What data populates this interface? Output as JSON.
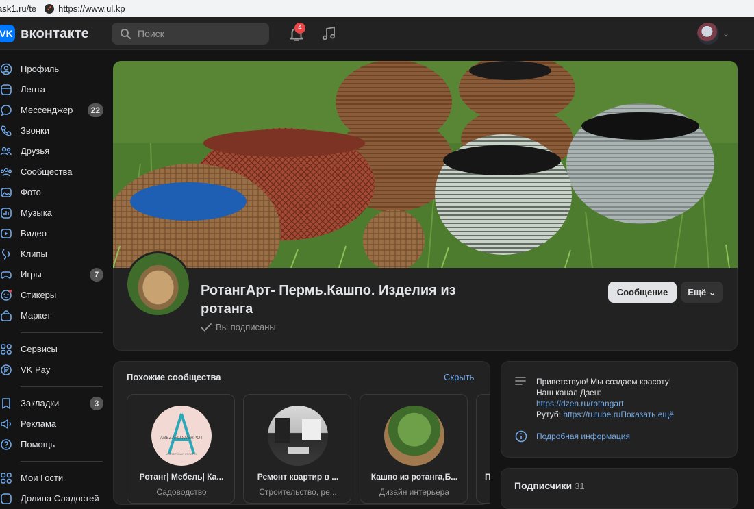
{
  "browser": {
    "bookmark1": "ask1.ru/te",
    "bookmark2": "https://www.ul.kp"
  },
  "header": {
    "logo_text": "вконтакте",
    "search_placeholder": "Поиск",
    "notifications_count": "4"
  },
  "sidebar": {
    "items": [
      {
        "label": "Профиль",
        "icon": "profile-icon"
      },
      {
        "label": "Лента",
        "icon": "feed-icon"
      },
      {
        "label": "Мессенджер",
        "icon": "messenger-icon",
        "count": "22"
      },
      {
        "label": "Звонки",
        "icon": "phone-icon"
      },
      {
        "label": "Друзья",
        "icon": "friends-icon"
      },
      {
        "label": "Сообщества",
        "icon": "communities-icon"
      },
      {
        "label": "Фото",
        "icon": "photo-icon"
      },
      {
        "label": "Музыка",
        "icon": "music-icon"
      },
      {
        "label": "Видео",
        "icon": "video-icon"
      },
      {
        "label": "Клипы",
        "icon": "clips-icon"
      },
      {
        "label": "Игры",
        "icon": "games-icon",
        "count": "7"
      },
      {
        "label": "Стикеры",
        "icon": "stickers-icon"
      },
      {
        "label": "Маркет",
        "icon": "market-icon"
      }
    ],
    "items2": [
      {
        "label": "Сервисы",
        "icon": "services-icon"
      },
      {
        "label": "VK Pay",
        "icon": "vkpay-icon"
      }
    ],
    "items3": [
      {
        "label": "Закладки",
        "icon": "bookmarks-icon",
        "count": "3"
      },
      {
        "label": "Реклама",
        "icon": "ads-icon"
      },
      {
        "label": "Помощь",
        "icon": "help-icon"
      }
    ],
    "items4": [
      {
        "label": "Мои Гости",
        "icon": "guests-icon"
      },
      {
        "label": "Долина Сладостей",
        "icon": "app-icon"
      }
    ]
  },
  "community": {
    "title": "РотангАрт- Пермь.Кашпо. Изделия из ротанга",
    "status": "Вы подписаны",
    "message_button": "Сообщение",
    "more_button": "Ещё"
  },
  "similar": {
    "title": "Похожие сообщества",
    "hide": "Скрыть",
    "tiles": [
      {
        "name": "Ротанг| Мебель| Ка...",
        "category": "Садоводство",
        "logo_text": "ABEZAFLOWERPOT",
        "logo_sub": "МАСТЕРСКАЯ РОТАНГА"
      },
      {
        "name": "Ремонт квартир в ...",
        "category": "Строительство, ре..."
      },
      {
        "name": "Кашпо из ротанга,Б...",
        "category": "Дизайн интерьера"
      },
      {
        "name": "П",
        "category": ""
      }
    ]
  },
  "info": {
    "line1": "Приветствую! Мы создаем красоту!",
    "line2": "Наш канал Дзен:",
    "link1": "https://dzen.ru/rotangart",
    "line3_prefix": "Рутуб: ",
    "link2": "https://rutube.ru",
    "show_more": "Показать ещё",
    "details": "Подробная информация"
  },
  "subscribers": {
    "title": "Подписчики",
    "count": "31"
  },
  "colors": {
    "accent": "#0077ff",
    "link": "#71aaeb",
    "background": "#141414",
    "card": "#222222",
    "badge_red": "#e64646"
  }
}
